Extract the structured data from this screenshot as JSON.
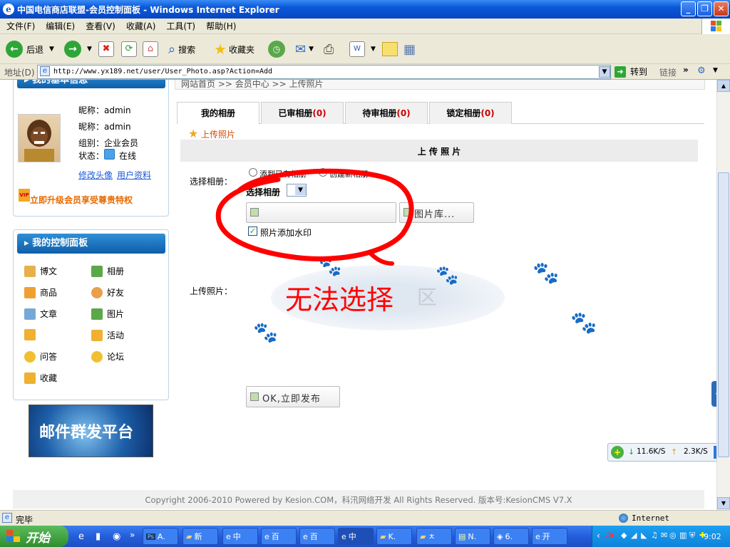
{
  "window": {
    "title": "中国电信商店联盟-会员控制面板 - Windows Internet Explorer",
    "min_label": "_",
    "max_label": "❐",
    "close_label": "✕"
  },
  "menu": [
    "文件(F)",
    "编辑(E)",
    "查看(V)",
    "收藏(A)",
    "工具(T)",
    "帮助(H)"
  ],
  "toolbar": {
    "back_label": "后退",
    "search_label": "搜索",
    "favorites_label": "收藏夹"
  },
  "address": {
    "label": "地址(D)",
    "url": "http://www.yx189.net/user/User_Photo.asp?Action=Add",
    "go_label": "转到",
    "links_label": "链接"
  },
  "breadcrumb": "网站首页 >> 会员中心 >> 上传照片",
  "left": {
    "basic_info_title": "我的基本信息",
    "nickname_row1": "昵称：admin",
    "nickname_row2": "昵称：admin",
    "group_row": "组别：企业会员",
    "status_label": "状态：",
    "status_value": "在线",
    "edit_avatar": "修改头像",
    "profile": "用户资料",
    "upgrade": "立即升级会员享受尊贵特权",
    "control_title": "我的控制面板",
    "menu_left": [
      "博文",
      "商品",
      "文章",
      "",
      "问答",
      "收藏"
    ],
    "menu_right": [
      "相册",
      "好友",
      "图片",
      "活动",
      "论坛"
    ],
    "banner": "邮件群发平台"
  },
  "tabs": [
    {
      "label": "我的相册",
      "count": ""
    },
    {
      "label": "已审相册",
      "count": "(0)"
    },
    {
      "label": "待审相册",
      "count": "(0)"
    },
    {
      "label": "锁定相册",
      "count": "(0)"
    }
  ],
  "upload": {
    "link": "上传照片",
    "header": "上 传 照 片",
    "select_album_label": "选择相册：",
    "radio_existing": "添到已有相册",
    "radio_new": "创建新相册",
    "select_album_bold": "选择相册",
    "library_button": "图片库...",
    "watermark_label": "照片添加水印",
    "upload_label": "上传照片：",
    "annotation": "无法选择",
    "dropzone_hint": "区",
    "publish_button": "OK,立即发布"
  },
  "footer": "Copyright 2006-2010 Powered by Kesion.COM，科汛网络开发  All Rights Reserved. 版本号:KesionCMS V7.X",
  "net_speed": {
    "down": "11.6K/S",
    "up": "2.3K/S"
  },
  "status": {
    "left": "完毕",
    "zone": "Internet"
  },
  "taskbar": {
    "start": "开始",
    "tasks": [
      "A.",
      "新",
      "中",
      "百",
      "百",
      "中",
      "K.",
      "ㅊ",
      "N.",
      "6.",
      "开"
    ],
    "clock": "9:02"
  },
  "colors": {
    "accent_red": "#cc0000",
    "panel_blue": "#1a6fc0",
    "annotation_red": "#ff0000"
  }
}
